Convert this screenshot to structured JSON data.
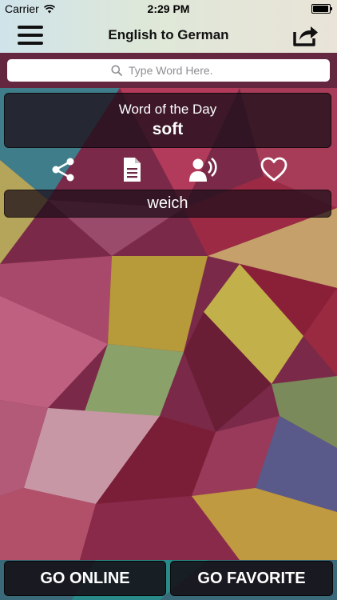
{
  "status_bar": {
    "carrier": "Carrier",
    "time": "2:29 PM",
    "icons": [
      "wifi-icon",
      "battery-icon"
    ]
  },
  "nav": {
    "title": "English to German",
    "left_icon": "menu-icon",
    "right_icon": "share-export-icon"
  },
  "search": {
    "placeholder": "Type Word Here.",
    "value": "",
    "icon": "search-icon"
  },
  "word_of_day": {
    "label": "Word of the Day",
    "word": "soft"
  },
  "actions": [
    {
      "icon": "share-icon"
    },
    {
      "icon": "document-icon"
    },
    {
      "icon": "speak-icon"
    },
    {
      "icon": "heart-icon"
    }
  ],
  "translation": "weich",
  "bottom": {
    "online_label": "GO ONLINE",
    "favorite_label": "GO FAVORITE"
  },
  "colors": {
    "card_bg": "#1e0f19",
    "text": "#ffffff",
    "nav_bg": "#dfe8d8"
  }
}
